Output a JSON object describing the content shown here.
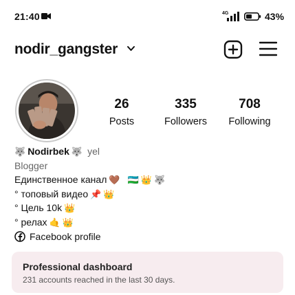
{
  "status_bar": {
    "time": "21:40",
    "network": "4G",
    "battery": "43%",
    "icons": [
      "video-icon",
      "signal-icon",
      "battery-icon"
    ]
  },
  "header": {
    "username": "nodir_gangster",
    "icons": [
      "chevron-down-icon",
      "add-post-icon",
      "menu-icon"
    ]
  },
  "profile": {
    "avatar": "avatar-photo",
    "stats": [
      {
        "value": "26",
        "label": "Posts"
      },
      {
        "value": "335",
        "label": "Followers"
      },
      {
        "value": "708",
        "label": "Following"
      }
    ]
  },
  "bio": {
    "name": "Nodirbek",
    "name_emoji": "🐺",
    "pronoun": "yel",
    "category": "Blogger",
    "line1": "Единственное канал",
    "line1_emojis": [
      "🤎",
      "🇺🇿",
      "👑",
      "🐺"
    ],
    "line2": "° топовый видео",
    "line2_emojis": [
      "📌",
      "👑"
    ],
    "line3": "° Цель 10k",
    "line3_emojis": [
      "👑"
    ],
    "line4": "° релах",
    "line4_emojis": [
      "🤙",
      "👑"
    ],
    "facebook_link": "Facebook profile"
  },
  "dashboard": {
    "title": "Professional dashboard",
    "subtitle": "231 accounts reached in the last 30 days.",
    "background": "#f7ecef"
  }
}
